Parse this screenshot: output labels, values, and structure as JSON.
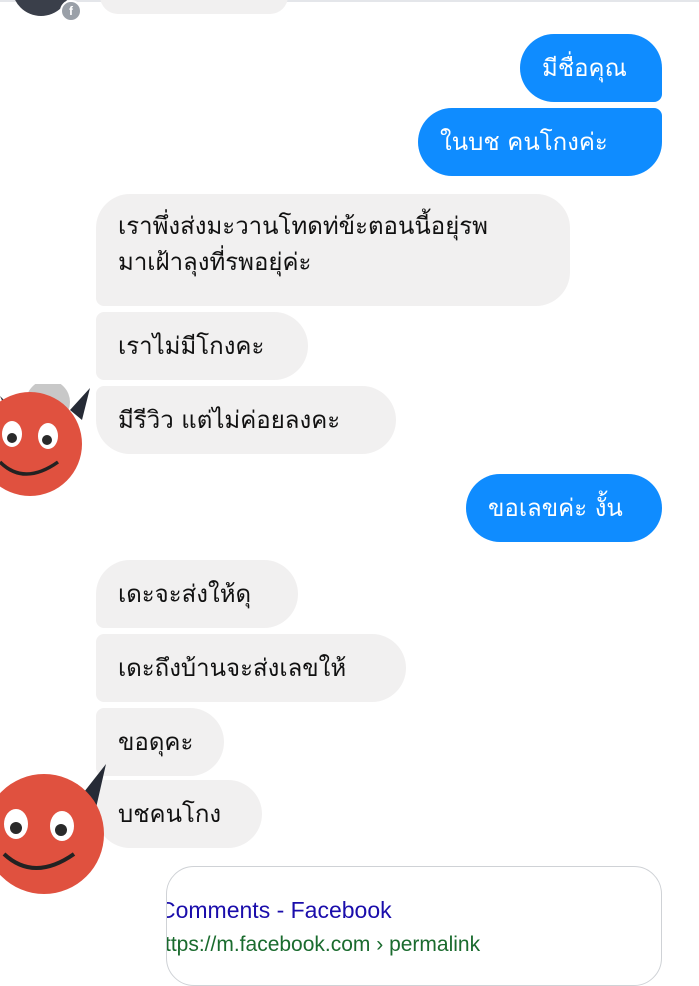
{
  "conversation": {
    "messages": [
      {
        "side": "outgoing",
        "text": "มีชื่อคุณ"
      },
      {
        "side": "outgoing",
        "text": "ในบช คนโกงค่ะ"
      },
      {
        "side": "incoming",
        "lines": [
          "เราพึ่งส่งมะวานโทดท่ข้ะตอนนี้อยุ่รพ",
          "มาเฝ้าลุงที่รพอยุ่ค่ะ"
        ]
      },
      {
        "side": "incoming",
        "text": "เราไม่มีโกงคะ"
      },
      {
        "side": "incoming",
        "text": "มีรีวิว แต่ไม่ค่อยลงคะ"
      },
      {
        "side": "outgoing",
        "text": "ขอเลขค่ะ งั้น"
      },
      {
        "side": "incoming",
        "text": "เดะจะส่งให้ดุ"
      },
      {
        "side": "incoming",
        "text": "เดะถึงบ้านจะส่งเลขให้"
      },
      {
        "side": "incoming",
        "text": "ขอดุคะ"
      },
      {
        "side": "incoming",
        "text": "บชคนโกง"
      }
    ]
  },
  "link_preview": {
    "title": "Comments - Facebook",
    "url": "ttps://m.facebook.com › permalink"
  },
  "icons": {
    "contact_avatar": "red-devil-emoji",
    "badge": "facebook-badge-icon"
  },
  "colors": {
    "outgoing_bubble": "#0f8cff",
    "incoming_bubble": "#f1f0f0",
    "devil_face": "#e0513f",
    "link_title": "#1a0dab",
    "link_url": "#1a6b2e"
  }
}
